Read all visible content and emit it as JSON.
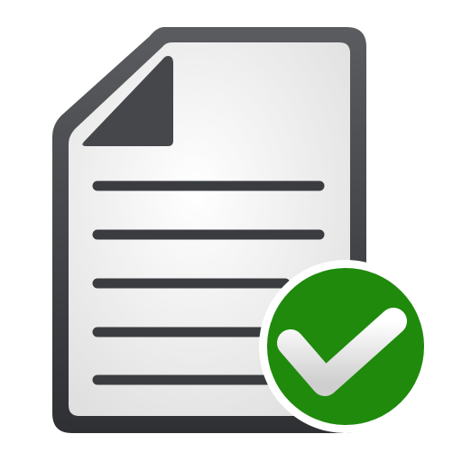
{
  "icon": {
    "name": "document-approved-icon",
    "parts": {
      "document": "document-icon",
      "badge": "checkmark-badge-icon"
    },
    "colors": {
      "frame_top": "#5a5c60",
      "frame_bottom": "#2e3034",
      "paper_light": "#ffffff",
      "paper_dark": "#dedede",
      "fold": "#45474b",
      "text_lines": "#3a3c40",
      "badge_fill": "#1f8a0c",
      "badge_ring": "#ffffff",
      "check_light": "#ffffff",
      "check_dark": "#cfcfcf"
    }
  }
}
